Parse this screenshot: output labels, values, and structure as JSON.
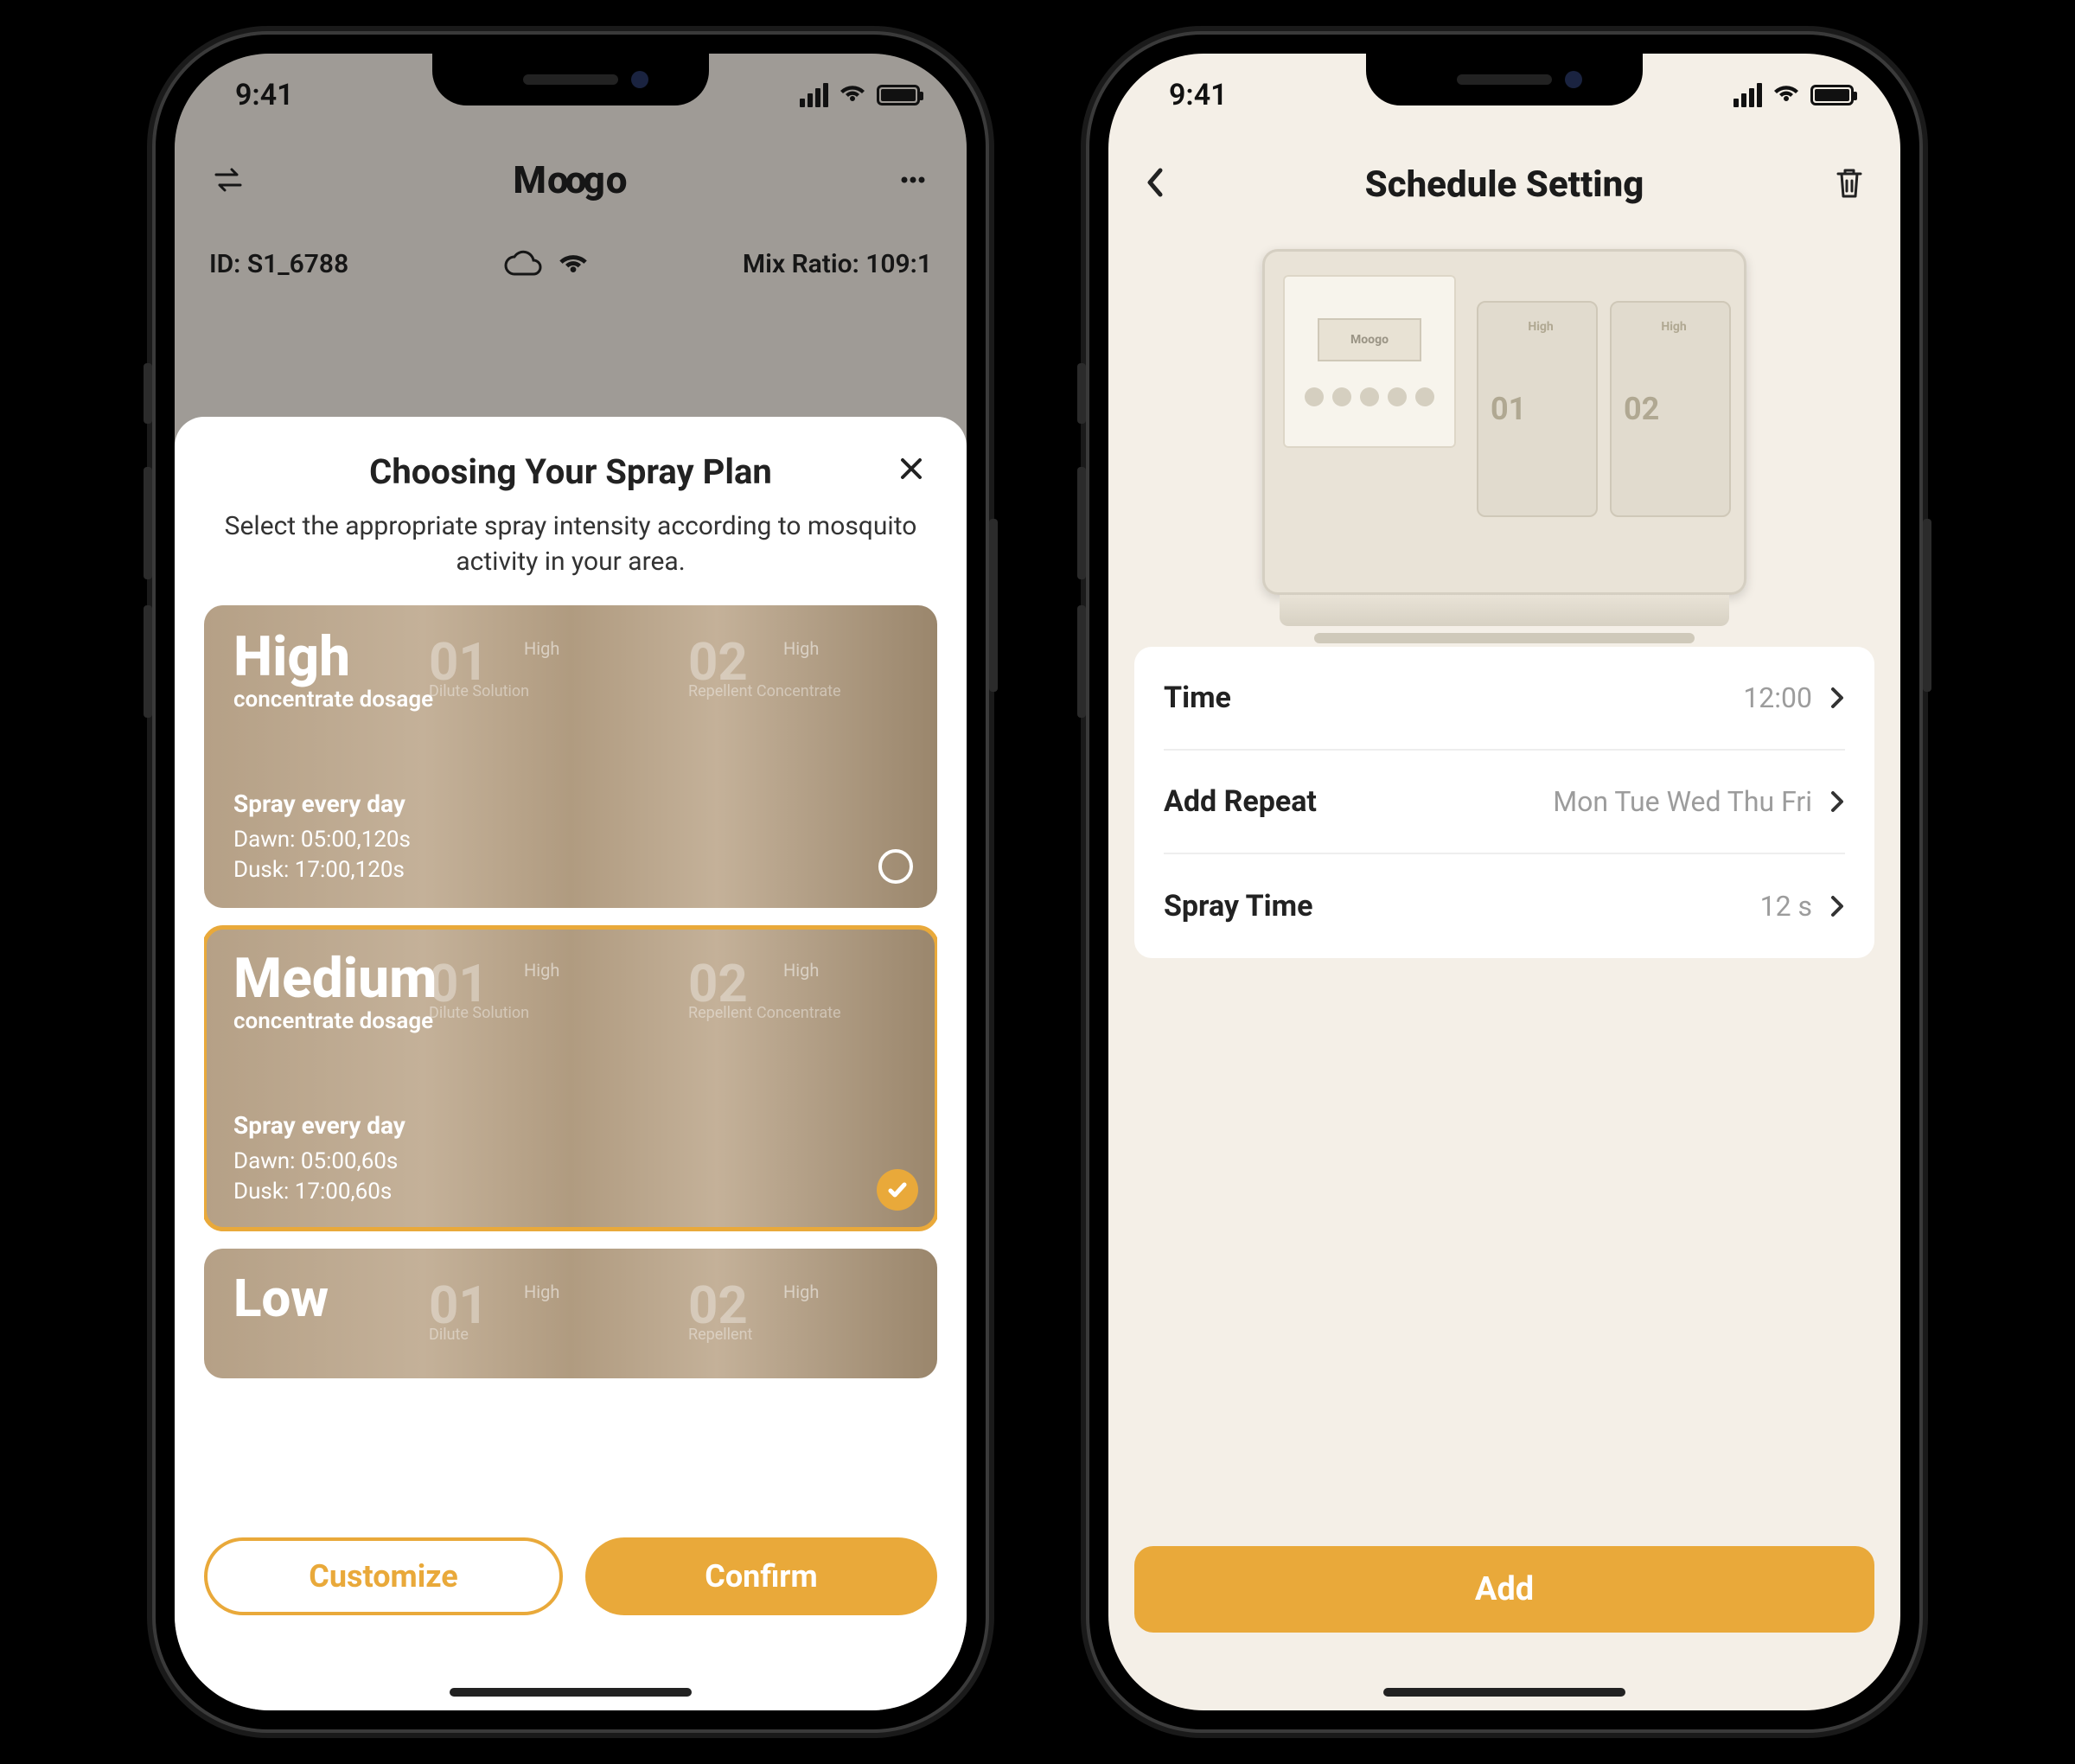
{
  "status": {
    "time": "9:41"
  },
  "phone1": {
    "nav": {
      "logo": "Moogo"
    },
    "info": {
      "id_label": "ID:",
      "id_value": "S1_6788",
      "mix_label": "Mix Ratio:",
      "mix_value": "109:1"
    },
    "sheet": {
      "title": "Choosing Your Spray Plan",
      "subtitle": "Select the appropriate spray intensity according to mosquito activity in your area.",
      "plans": [
        {
          "name": "High",
          "dosage": "concentrate dosage",
          "freq": "Spray every day",
          "dawn": "Dawn: 05:00,120s",
          "dusk": "Dusk: 17:00,120s",
          "selected": false,
          "bg": {
            "n1": "01",
            "n2": "02",
            "s": "High",
            "d1": "Dilute\nSolution",
            "d2": "Repellent\nConcentrate"
          }
        },
        {
          "name": "Medium",
          "dosage": "concentrate dosage",
          "freq": "Spray every day",
          "dawn": "Dawn: 05:00,60s",
          "dusk": "Dusk: 17:00,60s",
          "selected": true,
          "bg": {
            "n1": "01",
            "n2": "02",
            "s": "High",
            "d1": "Dilute\nSolution",
            "d2": "Repellent\nConcentrate"
          }
        },
        {
          "name": "Low",
          "dosage": "",
          "freq": "",
          "dawn": "",
          "dusk": "",
          "selected": false,
          "bg": {
            "n1": "01",
            "n2": "02",
            "s": "High",
            "d1": "Dilute",
            "d2": "Repellent"
          }
        }
      ],
      "actions": {
        "customize": "Customize",
        "confirm": "Confirm"
      }
    }
  },
  "phone2": {
    "title": "Schedule Setting",
    "device": {
      "logo": "Moogo",
      "tank1": "01",
      "tank2": "02",
      "tanksmall": "High"
    },
    "settings": [
      {
        "label": "Time",
        "value": "12:00"
      },
      {
        "label": "Add Repeat",
        "value": "Mon Tue Wed Thu Fri"
      },
      {
        "label": "Spray Time",
        "value": "12 s"
      }
    ],
    "add_label": "Add"
  }
}
